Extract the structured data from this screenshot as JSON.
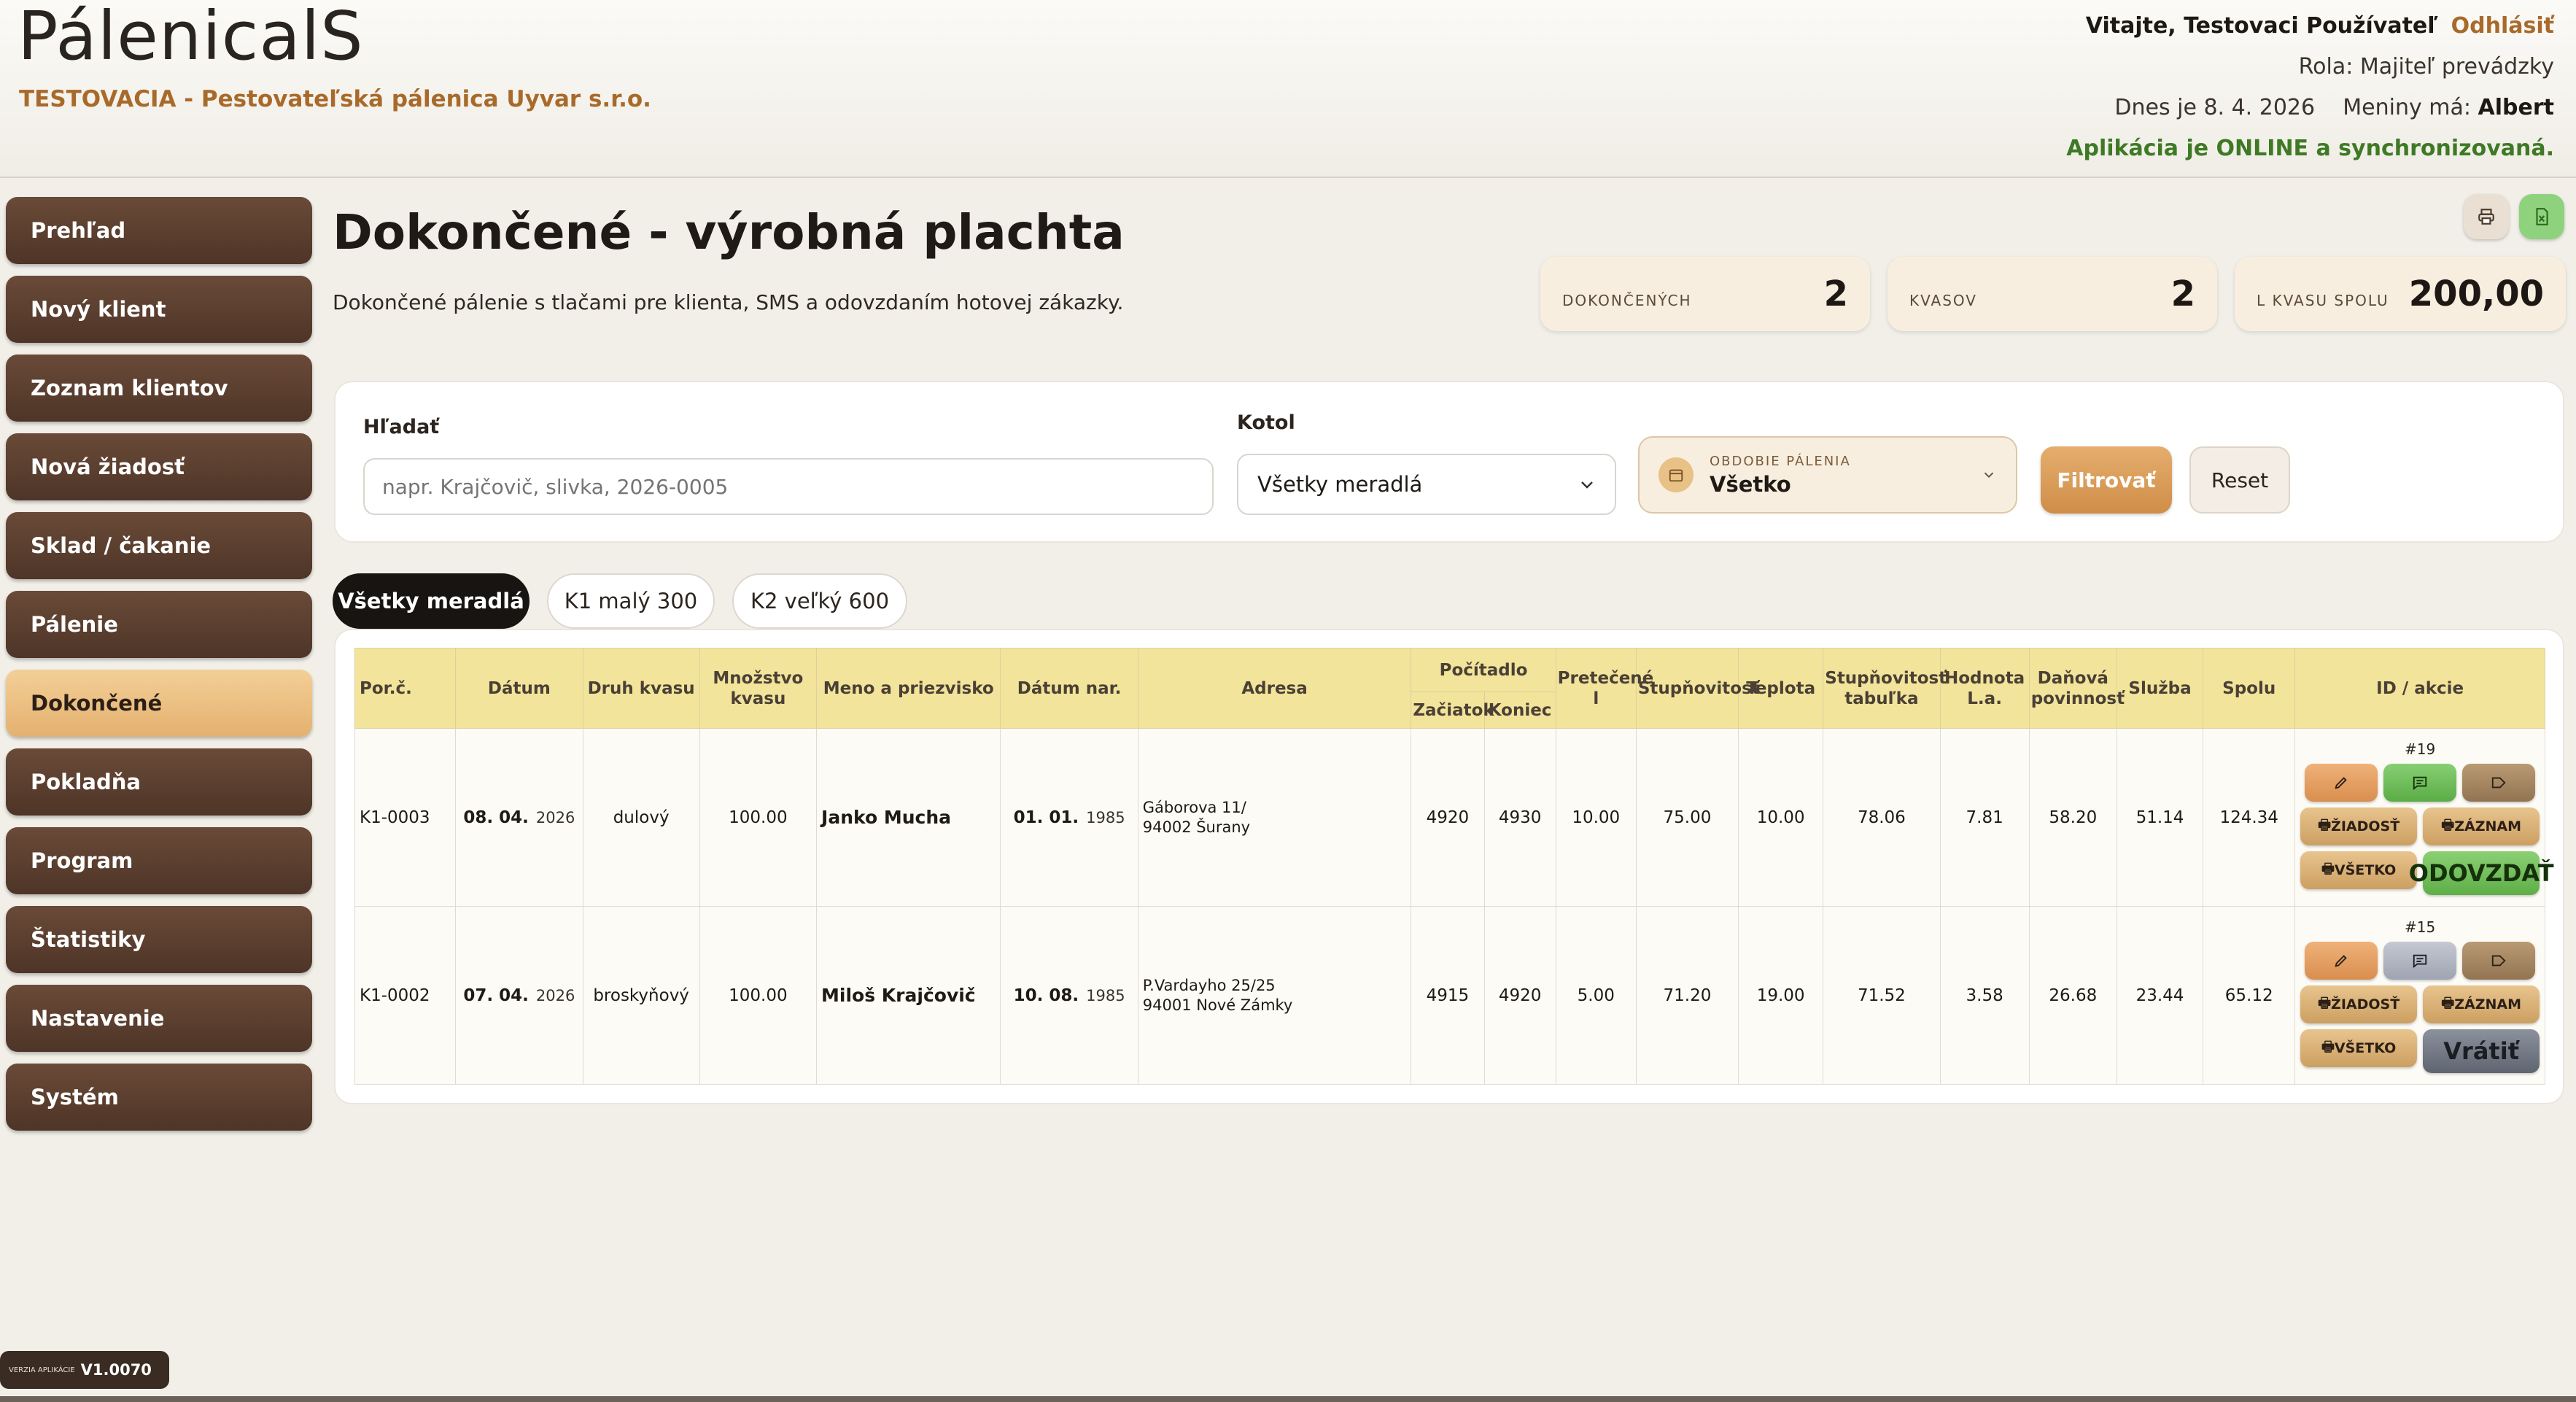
{
  "header": {
    "app_name": "PálenicalS",
    "company": "TESTOVACIA - Pestovateľská pálenica Uyvar s.r.o.",
    "welcome": "Vitajte, Testovaci Používateľ",
    "logout": "Odhlásiť",
    "role": "Rola: Majiteľ prevádzky",
    "today": "Dnes je 8. 4. 2026",
    "nameday_label": "Meniny má:",
    "nameday_name": "Albert",
    "status": "Aplikácia je ONLINE a synchronizovaná."
  },
  "sidebar": {
    "items": [
      {
        "label": "Prehľad"
      },
      {
        "label": "Nový klient"
      },
      {
        "label": "Zoznam klientov"
      },
      {
        "label": "Nová žiadosť"
      },
      {
        "label": "Sklad / čakanie"
      },
      {
        "label": "Pálenie"
      },
      {
        "label": "Dokončené"
      },
      {
        "label": "Pokladňa"
      },
      {
        "label": "Program"
      },
      {
        "label": "Štatistiky"
      },
      {
        "label": "Nastavenie"
      },
      {
        "label": "Systém"
      }
    ],
    "active_index": 6
  },
  "version": {
    "label": "VERZIA APLIKÁCIE",
    "value": "V1.0070"
  },
  "page": {
    "title": "Dokončené - výrobná plachta",
    "subtitle": "Dokončené pálenie s tlačami pre klienta, SMS a odovzdaním hotovej zákazky."
  },
  "stats": [
    {
      "label": "DOKONČENÝCH",
      "value": "2"
    },
    {
      "label": "KVASOV",
      "value": "2"
    },
    {
      "label": "L KVASU SPOLU",
      "value": "200,00"
    }
  ],
  "filters": {
    "search_label": "Hľadať",
    "search_placeholder": "napr. Krajčovič, slivka, 2026-0005",
    "kotol_label": "Kotol",
    "kotol_value": "Všetky meradlá",
    "period_label": "OBDOBIE PÁLENIA",
    "period_value": "Všetko",
    "filter_button": "Filtrovať",
    "reset_button": "Reset"
  },
  "tabs": [
    {
      "label": "Všetky meradlá"
    },
    {
      "label": "K1 malý 300"
    },
    {
      "label": "K2 veľký 600"
    }
  ],
  "table": {
    "headers": {
      "por": "Por.č.",
      "datum": "Dátum",
      "druh": "Druh kvasu",
      "mnozstvo": "Množstvo kvasu",
      "meno": "Meno a priezvisko",
      "datum_nar": "Dátum nar.",
      "adresa": "Adresa",
      "pocitadlo": "Počítadlo",
      "zaciatok": "Začiatok",
      "koniec": "Koniec",
      "pretecene": "Pretečené l",
      "stupnovitost": "Stupňovitosť",
      "teplota": "Teplota",
      "stupnovitost_tab": "Stupňovitosť tabuľka",
      "hodnota": "Hodnota L.a.",
      "danova": "Daňová povinnosť",
      "sluzba": "Služba",
      "spolu": "Spolu",
      "akcie": "ID / akcie"
    },
    "rows": [
      {
        "por": "K1-0003",
        "datum_dm": "08. 04.",
        "datum_y": "2026",
        "druh": "dulový",
        "mnozstvo": "100.00",
        "meno": "Janko Mucha",
        "nar_dm": "01. 01.",
        "nar_y": "1985",
        "adresa1": "Gáborova 11/",
        "adresa2": "94002 Šurany",
        "zaciatok": "4920",
        "koniec": "4930",
        "pretecene": "10.00",
        "stupnovitost": "75.00",
        "teplota": "10.00",
        "stupnovitost_tab": "78.06",
        "hodnota": "7.81",
        "danova": "58.20",
        "sluzba": "51.14",
        "spolu": "124.34",
        "id": "#19",
        "final_action": "ODOVZDAŤ"
      },
      {
        "por": "K1-0002",
        "datum_dm": "07. 04.",
        "datum_y": "2026",
        "druh": "broskyňový",
        "mnozstvo": "100.00",
        "meno": "Miloš Krajčovič",
        "nar_dm": "10. 08.",
        "nar_y": "1985",
        "adresa1": "P.Vardayho 25/25",
        "adresa2": "94001 Nové Zámky",
        "zaciatok": "4915",
        "koniec": "4920",
        "pretecene": "5.00",
        "stupnovitost": "71.20",
        "teplota": "19.00",
        "stupnovitost_tab": "71.52",
        "hodnota": "3.58",
        "danova": "26.68",
        "sluzba": "23.44",
        "spolu": "65.12",
        "id": "#15",
        "final_action": "Vrátiť"
      }
    ],
    "action_labels": {
      "ziadost": "ŽIADOSŤ",
      "zaznam": "ZÁZNAM",
      "vsetko": "VŠETKO"
    }
  },
  "colors": {
    "nav_bg": "#5a3e2e",
    "nav_active": "#ecc283",
    "accent": "#a86a2a",
    "online": "#3e7a25",
    "table_header": "#f2e49a"
  }
}
